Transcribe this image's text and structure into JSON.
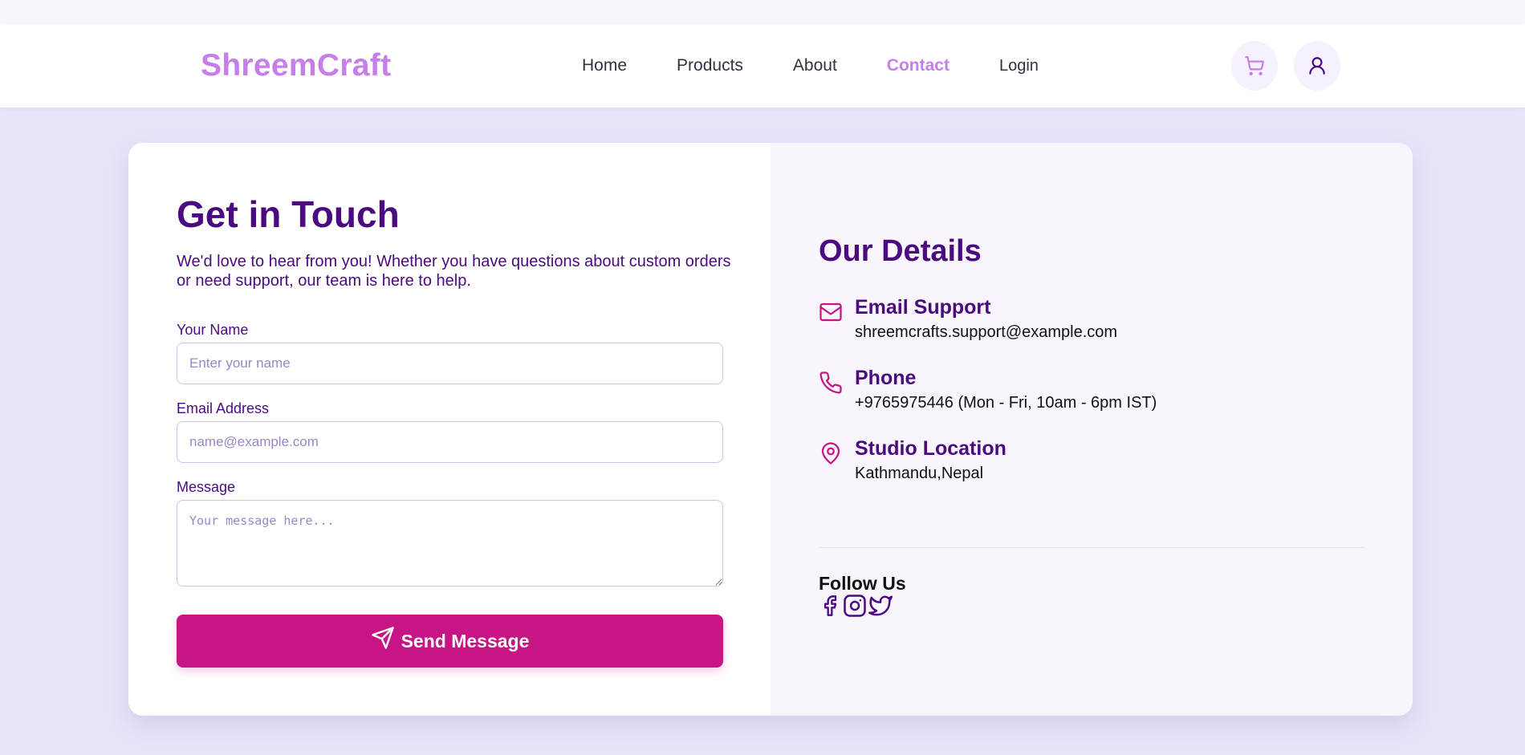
{
  "nav": {
    "logo": "ShreemCraft",
    "links": [
      {
        "label": "Home",
        "active": false
      },
      {
        "label": "Products",
        "active": false
      },
      {
        "label": "About",
        "active": false
      },
      {
        "label": "Contact",
        "active": true
      },
      {
        "label": "Login",
        "active": false
      }
    ],
    "icons": [
      "cart-icon",
      "user-icon"
    ]
  },
  "form": {
    "title": "Get in Touch",
    "intro": "We'd love to hear from you! Whether you have questions about custom orders or need support, our team is here to help.",
    "name_label": "Your Name",
    "name_placeholder": "Enter your name",
    "name_value": "",
    "email_label": "Email Address",
    "email_placeholder": "name@example.com",
    "email_value": "",
    "message_label": "Message",
    "message_placeholder": "Your message here...",
    "message_value": "",
    "submit_label": "Send Message",
    "submit_icon": "send-icon"
  },
  "details": {
    "title": "Our Details",
    "items": [
      {
        "icon": "mail-icon",
        "heading": "Email Support",
        "value": "shreemcrafts.support@example.com"
      },
      {
        "icon": "phone-icon",
        "heading": "Phone",
        "value": "+9765975446 (Mon - Fri, 10am - 6pm IST)"
      },
      {
        "icon": "map-pin-icon",
        "heading": "Studio Location",
        "value": "Kathmandu,Nepal"
      }
    ],
    "follow_label": "Follow Us",
    "socials": [
      "facebook-icon",
      "instagram-icon",
      "twitter-icon"
    ]
  },
  "colors": {
    "brand": "#c77dea",
    "heading": "#4b0a80",
    "button": "#c71585",
    "page_bg": "#e6e6fa",
    "panel_bg": "#f8f5fd"
  }
}
